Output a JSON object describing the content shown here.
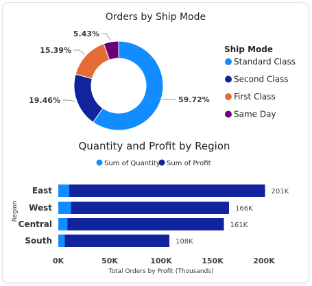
{
  "chart_data": [
    {
      "type": "pie",
      "title": "Orders by Ship Mode",
      "legend_title": "Ship Mode",
      "legend_position": "right",
      "colors": [
        "#118DFF",
        "#12239E",
        "#E66C37",
        "#6B007B"
      ],
      "slices": [
        {
          "label": "Standard Class",
          "value": 59.72,
          "display": "59.72%"
        },
        {
          "label": "Second Class",
          "value": 19.46,
          "display": "19.46%"
        },
        {
          "label": "First Class",
          "value": 15.39,
          "display": "15.39%"
        },
        {
          "label": "Same Day",
          "value": 5.43,
          "display": "5.43%"
        }
      ]
    },
    {
      "type": "bar",
      "orientation": "horizontal",
      "stacked": true,
      "title": "Quantity and Profit by Region",
      "xlabel": "Total Orders by Profit (Thousands)",
      "ylabel": "Region",
      "legend_position": "top",
      "xlim": [
        0,
        200000
      ],
      "x_ticks": [
        "0K",
        "50K",
        "100K",
        "150K",
        "200K"
      ],
      "x_tick_values": [
        0,
        50000,
        100000,
        150000,
        200000
      ],
      "categories": [
        "East",
        "West",
        "Central",
        "South"
      ],
      "series": [
        {
          "name": "Sum of Quantity",
          "color": "#118DFF",
          "values": [
            10600,
            12300,
            8800,
            6200
          ]
        },
        {
          "name": "Sum of Profit",
          "color": "#12239E",
          "values": [
            190400,
            153700,
            152200,
            101800
          ]
        }
      ],
      "data_labels": [
        "201K",
        "166K",
        "161K",
        "108K"
      ]
    }
  ]
}
